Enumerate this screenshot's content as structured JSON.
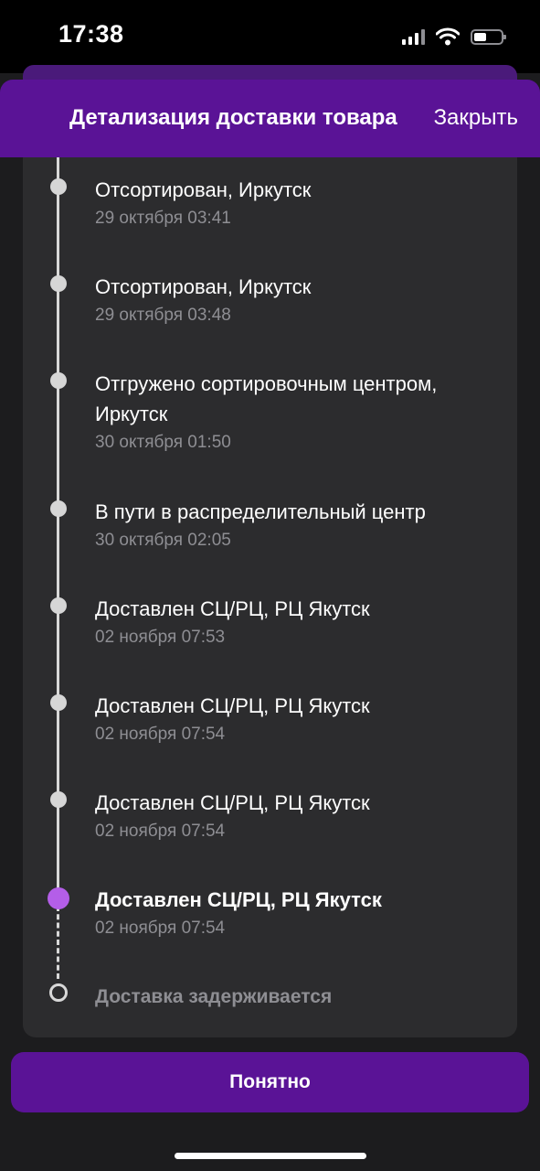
{
  "status_bar": {
    "time": "17:38"
  },
  "header": {
    "title": "Детализация доставки товара",
    "close_label": "Закрыть"
  },
  "events": [
    {
      "title": "Отсортирован, Иркутск",
      "date": "29 октября 03:41"
    },
    {
      "title": "Отсортирован, Иркутск",
      "date": "29 октября 03:48"
    },
    {
      "title": "Отгружено сортировочным центром, Иркутск",
      "date": "30 октября 01:50"
    },
    {
      "title": "В пути в распределительный центр",
      "date": "30 октября 02:05"
    },
    {
      "title": "Доставлен СЦ/РЦ, РЦ Якутск",
      "date": "02 ноября 07:53"
    },
    {
      "title": "Доставлен СЦ/РЦ, РЦ Якутск",
      "date": "02 ноября 07:54"
    },
    {
      "title": "Доставлен СЦ/РЦ, РЦ Якутск",
      "date": "02 ноября 07:54"
    },
    {
      "title": "Доставлен СЦ/РЦ, РЦ Якутск",
      "date": "02 ноября 07:54",
      "current": true
    }
  ],
  "pending_event": {
    "title": "Доставка задерживается"
  },
  "footer": {
    "button_label": "Понятно"
  },
  "colors": {
    "accent": "#5a1396",
    "active_dot": "#b45ee8",
    "card": "#2c2c2e",
    "muted_text": "#8e8e93"
  }
}
